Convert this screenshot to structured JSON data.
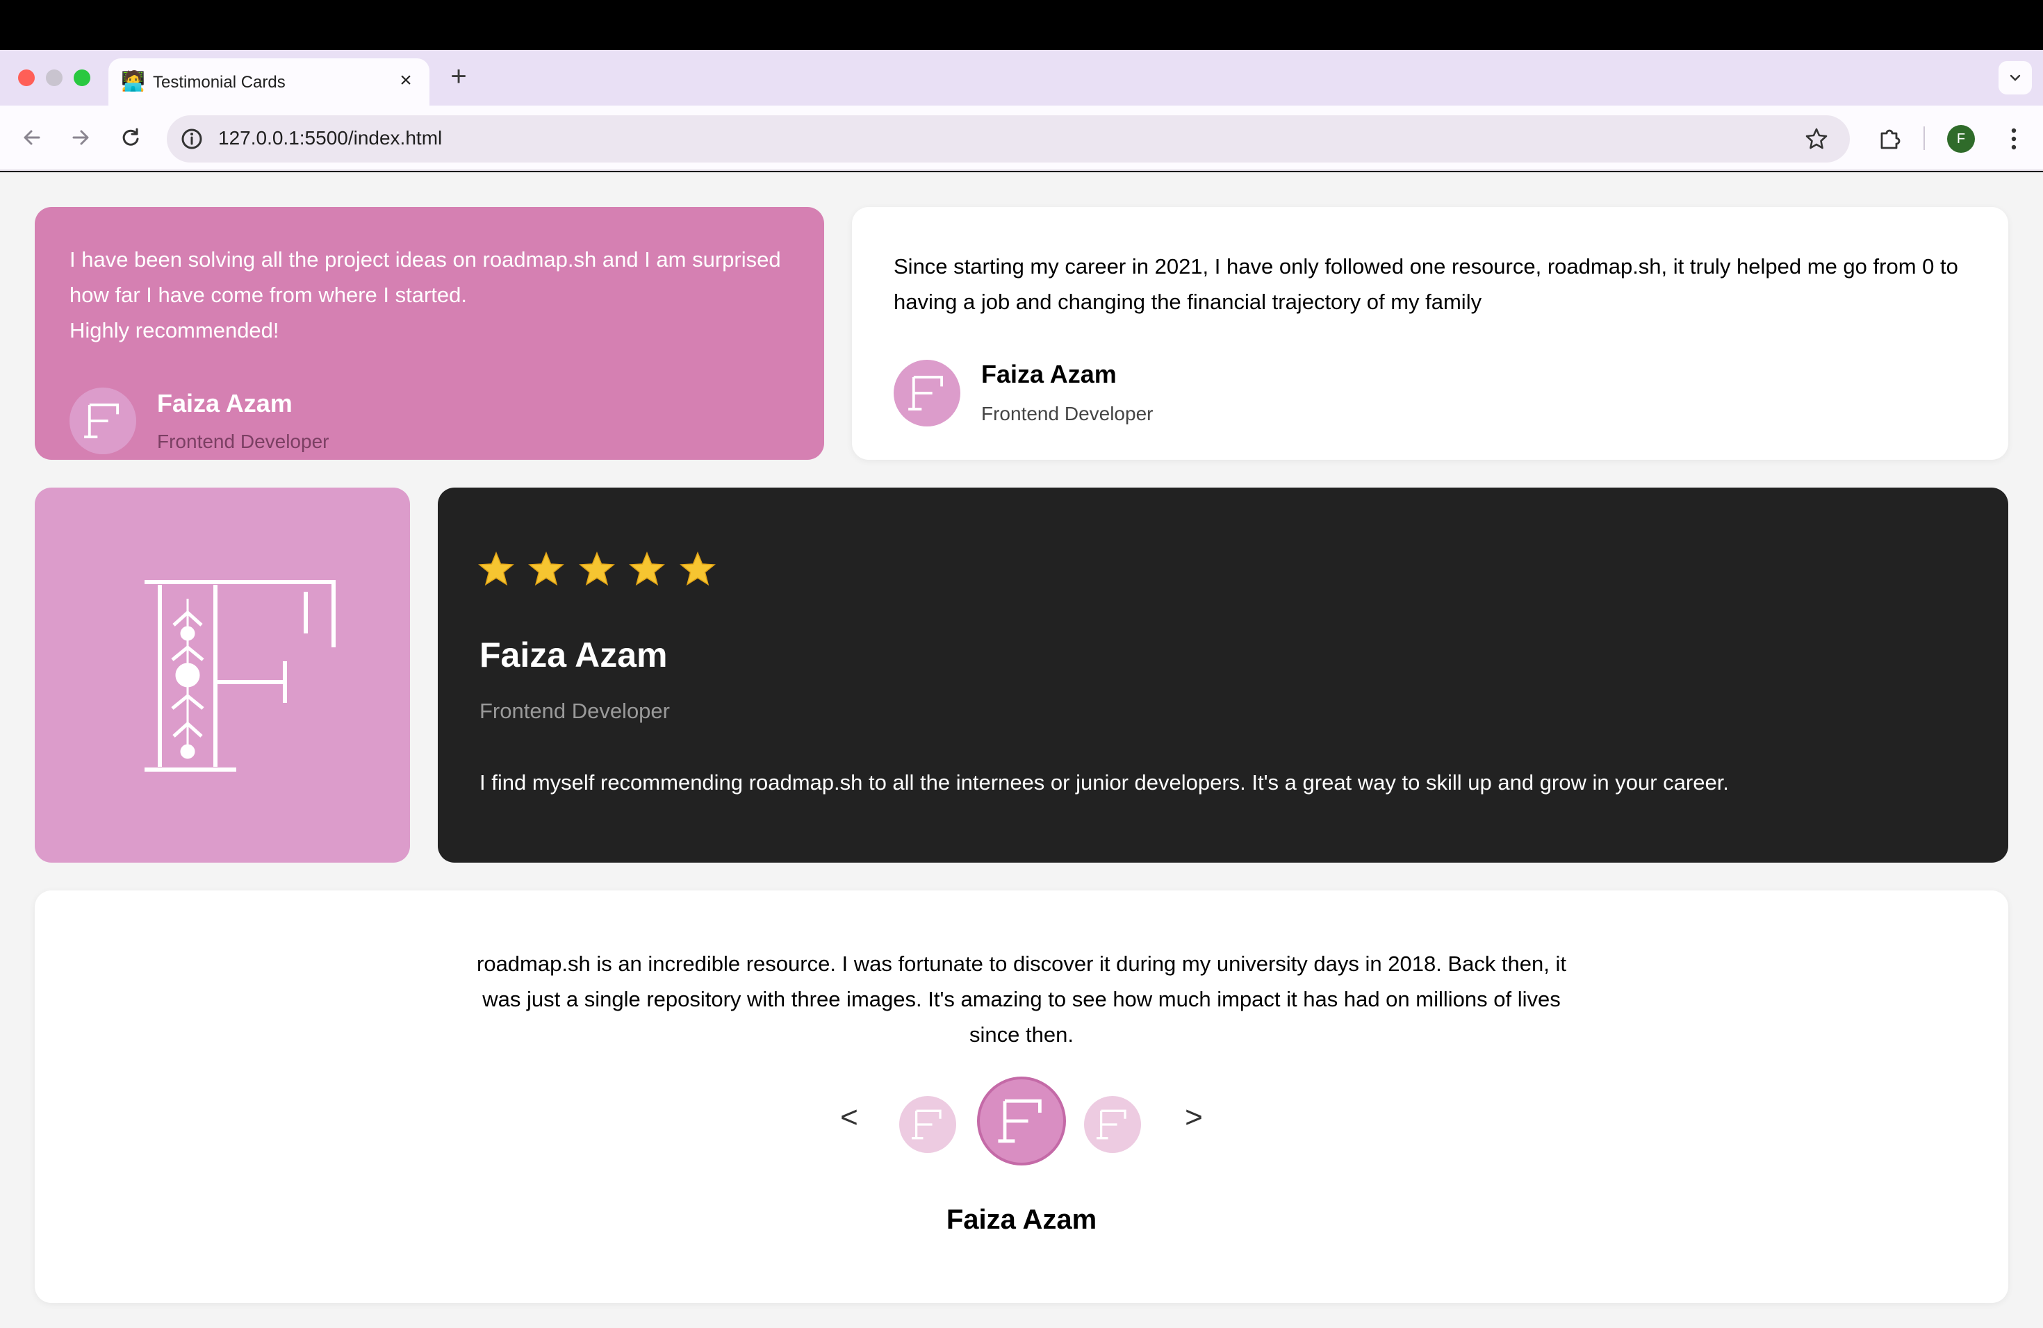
{
  "browser": {
    "tab_title": "Testimonial Cards",
    "tab_favicon": "🧑‍💻",
    "url": "127.0.0.1:5500/index.html",
    "profile_initial": "F"
  },
  "testimonials": {
    "card1": {
      "quote": "I have been solving all the project ideas on roadmap.sh and I am surprised how far I have come from where I started.\nHighly recommended!",
      "name": "Faiza Azam",
      "role": "Frontend Developer"
    },
    "card2": {
      "quote": "Since starting my career in 2021, I have only followed one resource, roadmap.sh, it truly helped me go from 0 to having a job and changing the financial trajectory of my family",
      "name": "Faiza Azam",
      "role": "Frontend Developer"
    },
    "card4": {
      "rating": 5,
      "name": "Faiza Azam",
      "role": "Frontend Developer",
      "quote": "I find myself recommending roadmap.sh to all the internees or junior developers. It's a great way to skill up and grow in your career."
    },
    "card5": {
      "quote": "roadmap.sh is an incredible resource. I was fortunate to discover it during my university days in 2018. Back then, it was just a single repository with three images. It's amazing to see how much impact it has had on millions of lives since then.",
      "prev_label": "<",
      "next_label": ">",
      "name": "Faiza Azam"
    }
  },
  "colors": {
    "card1_bg": "#d580b2",
    "avatar_bg": "#dc9ccb",
    "dark_card_bg": "#222222",
    "page_bg": "#f4f4f4"
  }
}
